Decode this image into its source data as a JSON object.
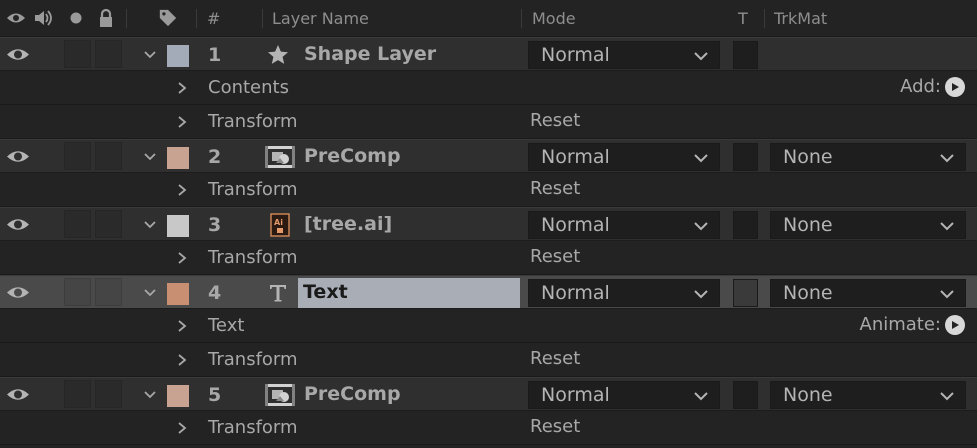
{
  "header": {
    "col_number": "#",
    "col_layer_name": "Layer Name",
    "col_mode": "Mode",
    "col_t": "T",
    "col_trkmat": "TrkMat"
  },
  "colors": {
    "label_blue": "#a3aab8",
    "label_peach": "#c9a391",
    "label_light": "#c8c8c8",
    "label_orange": "#c98f72",
    "selection": "#a9adb6"
  },
  "layers": [
    {
      "number": "1",
      "name": "Shape Layer",
      "icon": "star-icon",
      "mode": "Normal",
      "trkmat": null,
      "subs": [
        {
          "label": "Contents",
          "action": "Add:"
        },
        {
          "label": "Transform",
          "reset": "Reset"
        }
      ]
    },
    {
      "number": "2",
      "name": "PreComp",
      "icon": "precomp-icon",
      "mode": "Normal",
      "trkmat": "None",
      "subs": [
        {
          "label": "Transform",
          "reset": "Reset"
        }
      ]
    },
    {
      "number": "3",
      "name": "[tree.ai]",
      "icon": "illustrator-file-icon",
      "mode": "Normal",
      "trkmat": "None",
      "subs": [
        {
          "label": "Transform",
          "reset": "Reset"
        }
      ]
    },
    {
      "number": "4",
      "name": "Text",
      "icon": "text-layer-icon",
      "mode": "Normal",
      "trkmat": "None",
      "selected": true,
      "subs": [
        {
          "label": "Text",
          "action": "Animate:"
        },
        {
          "label": "Transform",
          "reset": "Reset"
        }
      ]
    },
    {
      "number": "5",
      "name": "PreComp",
      "icon": "precomp-icon",
      "mode": "Normal",
      "trkmat": "None",
      "subs": [
        {
          "label": "Transform",
          "reset": "Reset"
        }
      ]
    }
  ]
}
